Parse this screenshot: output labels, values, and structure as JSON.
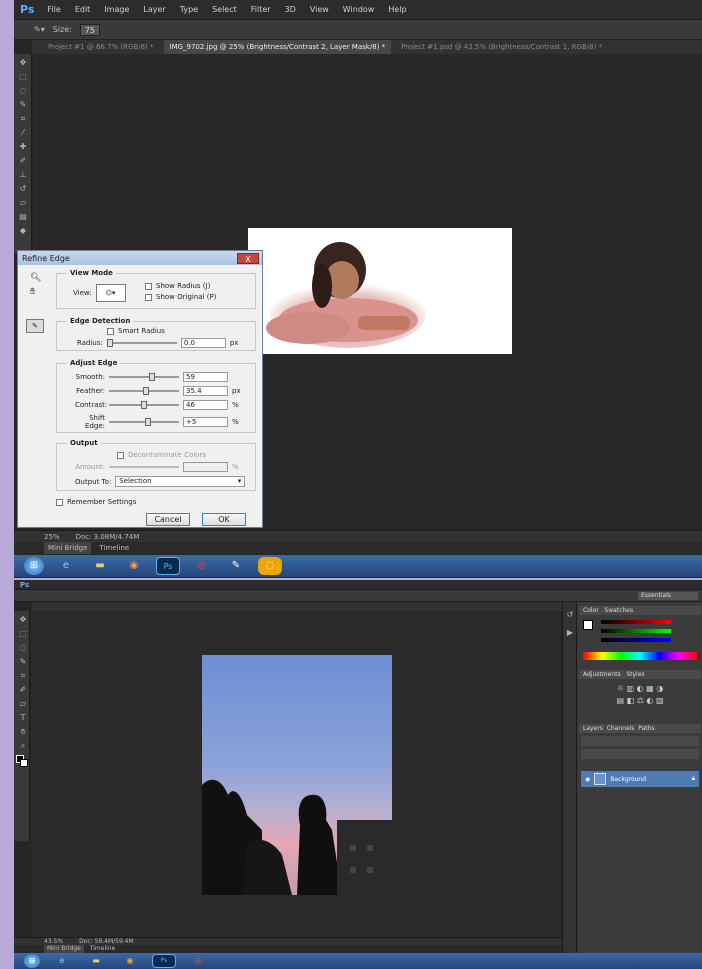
{
  "top": {
    "menu": [
      "File",
      "Edit",
      "Image",
      "Layer",
      "Type",
      "Select",
      "Filter",
      "3D",
      "View",
      "Window",
      "Help"
    ],
    "size_label": "Size:",
    "size_value": "75",
    "tabs": [
      "Project #1 @ 66.7% (RGB/8) *",
      "IMG_9702.jpg @ 25% (Brightness/Contrast 2, Layer Mask/8) *",
      "Project #1.psd @ 43.5% (Brightness/Contrast 1, RGB/8) *"
    ],
    "dialog": {
      "title": "Refine Edge",
      "close": "X",
      "view_mode": "View Mode",
      "view_label": "View:",
      "show_radius": "Show Radius (J)",
      "show_original": "Show Original (P)",
      "edge_detection": "Edge Detection",
      "smart_radius": "Smart Radius",
      "radius_label": "Radius:",
      "radius_value": "0.0",
      "radius_unit": "px",
      "adjust_edge": "Adjust Edge",
      "smooth_label": "Smooth:",
      "smooth_value": "59",
      "feather_label": "Feather:",
      "feather_value": "35.4",
      "feather_unit": "px",
      "contrast_label": "Contrast:",
      "contrast_value": "46",
      "contrast_unit": "%",
      "shift_label": "Shift Edge:",
      "shift_value": "+5",
      "shift_unit": "%",
      "output": "Output",
      "decontaminate": "Decontaminate Colors",
      "amount_label": "Amount:",
      "amount_unit": "%",
      "output_to_label": "Output To:",
      "output_to_value": "Selection",
      "remember": "Remember Settings",
      "cancel": "Cancel",
      "ok": "OK"
    },
    "status_zoom": "25%",
    "status_doc": "Doc: 3.08M/4.74M",
    "bridge_tabs": [
      "Mini Bridge",
      "Timeline"
    ]
  },
  "bottom": {
    "status_zoom": "43.5%",
    "status_doc": "Doc: 59.4M/59.4M",
    "bridge_tabs": [
      "Mini Bridge",
      "Timeline"
    ],
    "workspace": "Essentials",
    "panel_tabs": [
      "Color",
      "Swatches"
    ],
    "adj_tabs": [
      "Adjustments",
      "Styles"
    ],
    "layer_tabs": [
      "Layers",
      "Channels",
      "Paths"
    ],
    "layer_name": "Background"
  }
}
